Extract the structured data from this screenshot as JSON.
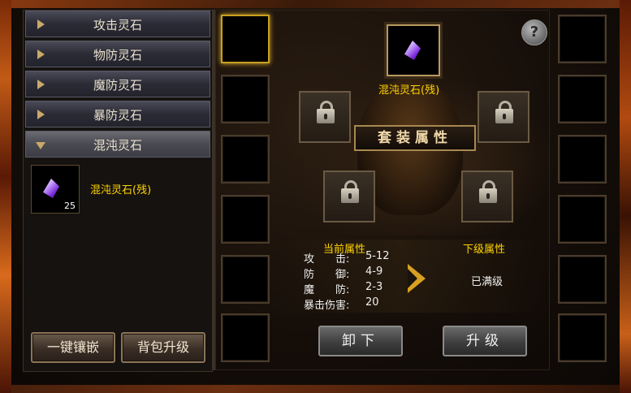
{
  "categories": [
    {
      "label": "攻击灵石"
    },
    {
      "label": "物防灵石"
    },
    {
      "label": "魔防灵石"
    },
    {
      "label": "暴防灵石"
    },
    {
      "label": "混沌灵石"
    }
  ],
  "open_category_index": 4,
  "inventory_item": {
    "name": "混沌灵石(残)",
    "count": "25",
    "icon": "purple-gem-icon"
  },
  "left_buttons": {
    "inlay_all": "一键镶嵌",
    "bag_upgrade": "背包升级"
  },
  "center": {
    "top_gem_name": "混沌灵石(残)",
    "banner": "套装属性",
    "help": "?"
  },
  "attributes": {
    "current_label": "当前属性",
    "next_label": "下级属性",
    "stats": [
      {
        "label": "攻　　击:",
        "value": "5-12"
      },
      {
        "label": "防　　御:",
        "value": "4-9"
      },
      {
        "label": "魔　　防:",
        "value": "2-3"
      },
      {
        "label": "暴击伤害:",
        "value": "20"
      }
    ],
    "next_status": "已满级"
  },
  "actions": {
    "unload": "卸下",
    "upgrade": "升级"
  },
  "colors": {
    "accent_gold": "#ffd400",
    "selected_border": "#c8a020"
  }
}
